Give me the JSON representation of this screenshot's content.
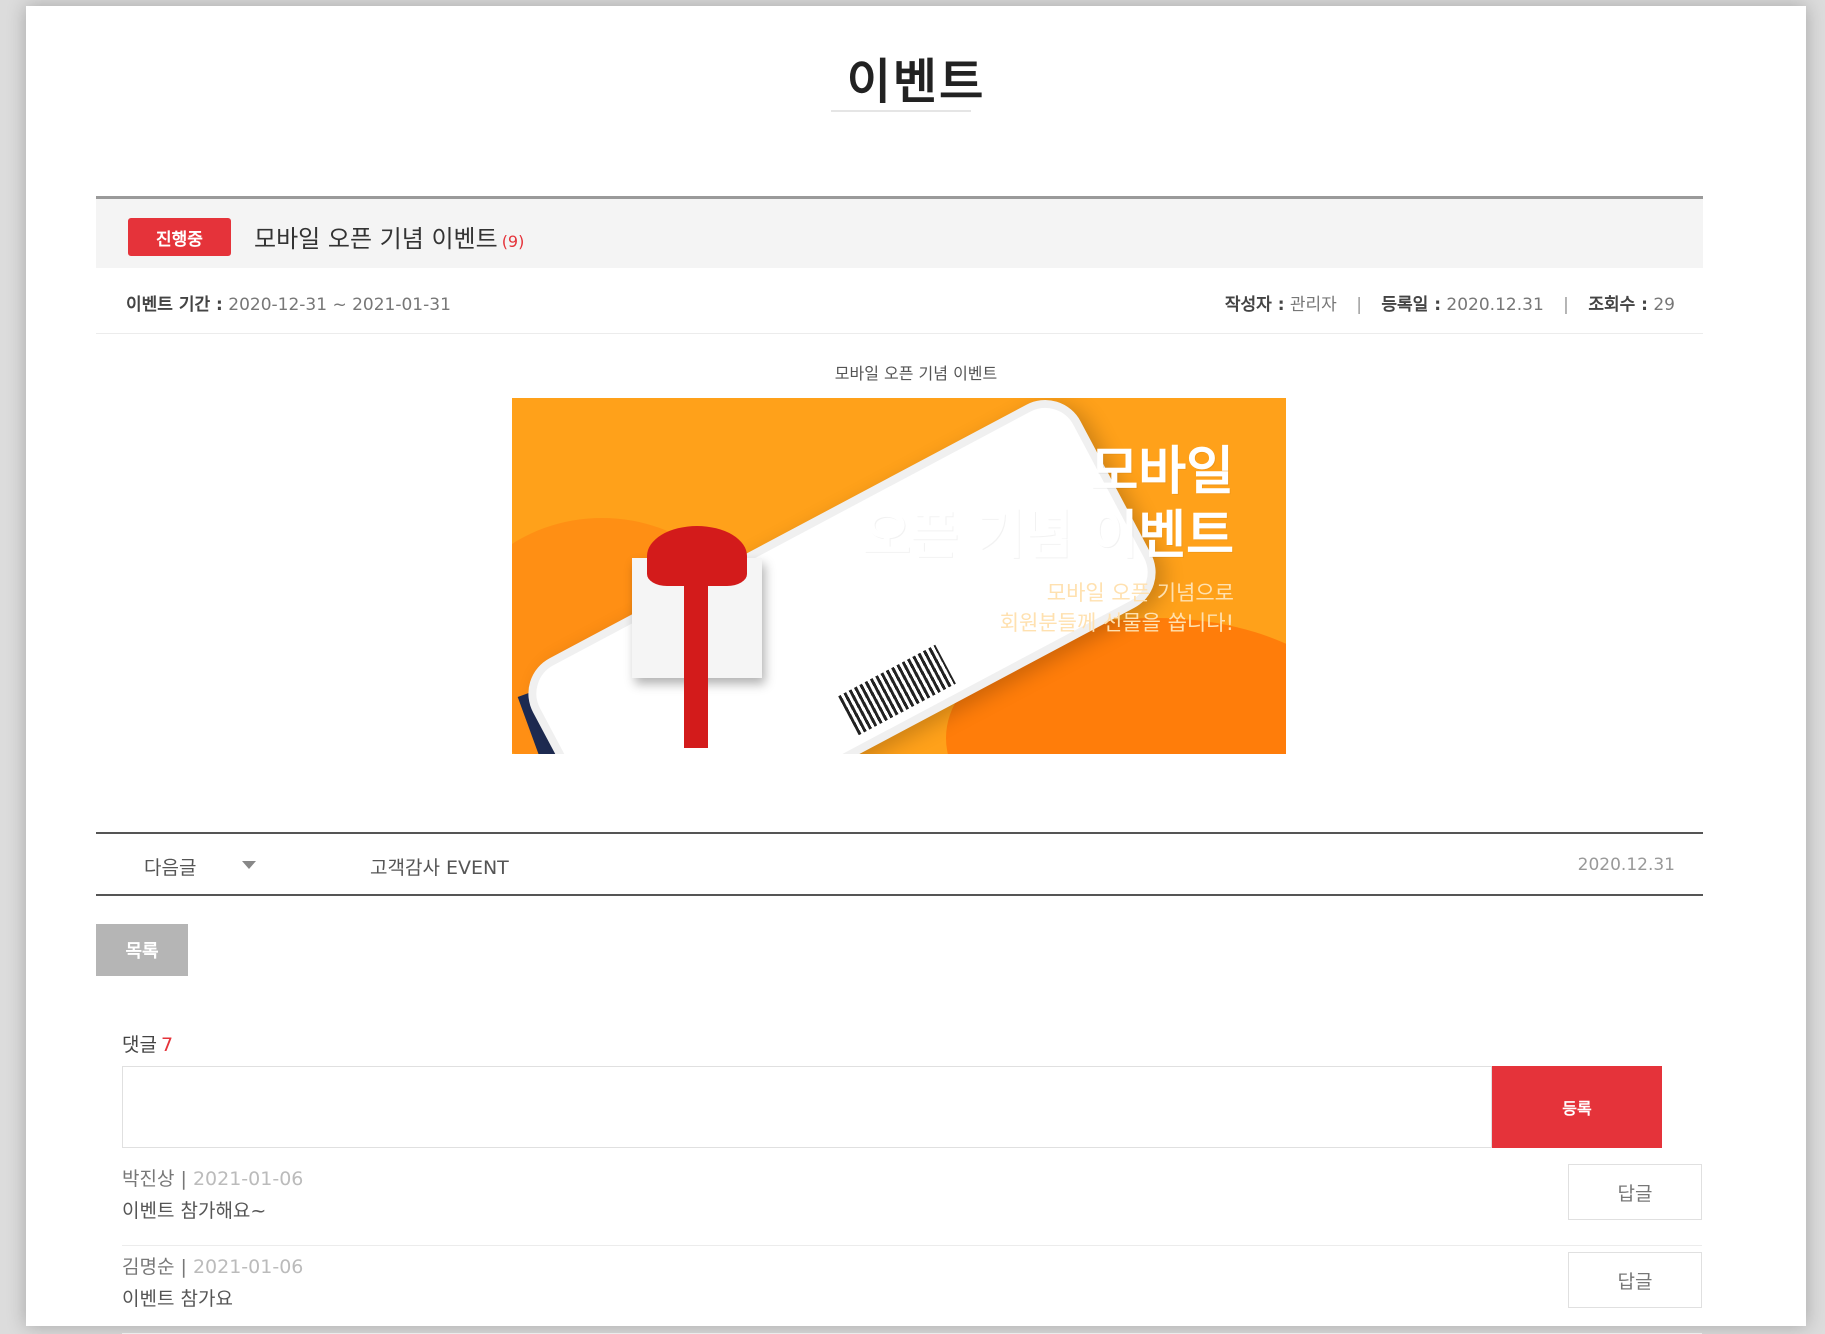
{
  "page": {
    "title": "이벤트"
  },
  "event": {
    "status": "진행중",
    "title": "모바일 오픈 기념 이벤트",
    "comment_count_mark": "(9)",
    "period_label": "이벤트 기간 :",
    "period_value": "2020-12-31 ~ 2021-01-31",
    "author_label": "작성자 :",
    "author_value": "관리자",
    "reg_label": "등록일 :",
    "reg_value": "2020.12.31",
    "views_label": "조회수 :",
    "views_value": "29",
    "content_caption": "모바일 오픈 기념 이벤트"
  },
  "banner": {
    "title_line1": "모바일",
    "title_line2": "오픈 기념 이벤트",
    "sub_line1": "모바일 오픈 기념으로",
    "sub_line2": "회원분들께 선물을 쏩니다!"
  },
  "next_post": {
    "label": "다음글",
    "title": "고객감사 EVENT",
    "date": "2020.12.31"
  },
  "list_button": "목록",
  "comments": {
    "heading": "댓글",
    "count": "7",
    "submit_label": "등록",
    "items": [
      {
        "author": "박진상",
        "date": "2021-01-06",
        "text": "이벤트 참가해요~",
        "reply_label": "답글"
      },
      {
        "author": "김명순",
        "date": "2021-01-06",
        "text": "이벤트 참가요",
        "reply_label": "답글"
      }
    ]
  },
  "colors": {
    "accent": "#e5333a",
    "banner": "#ffa11a",
    "list_button": "#b5b5b5"
  }
}
